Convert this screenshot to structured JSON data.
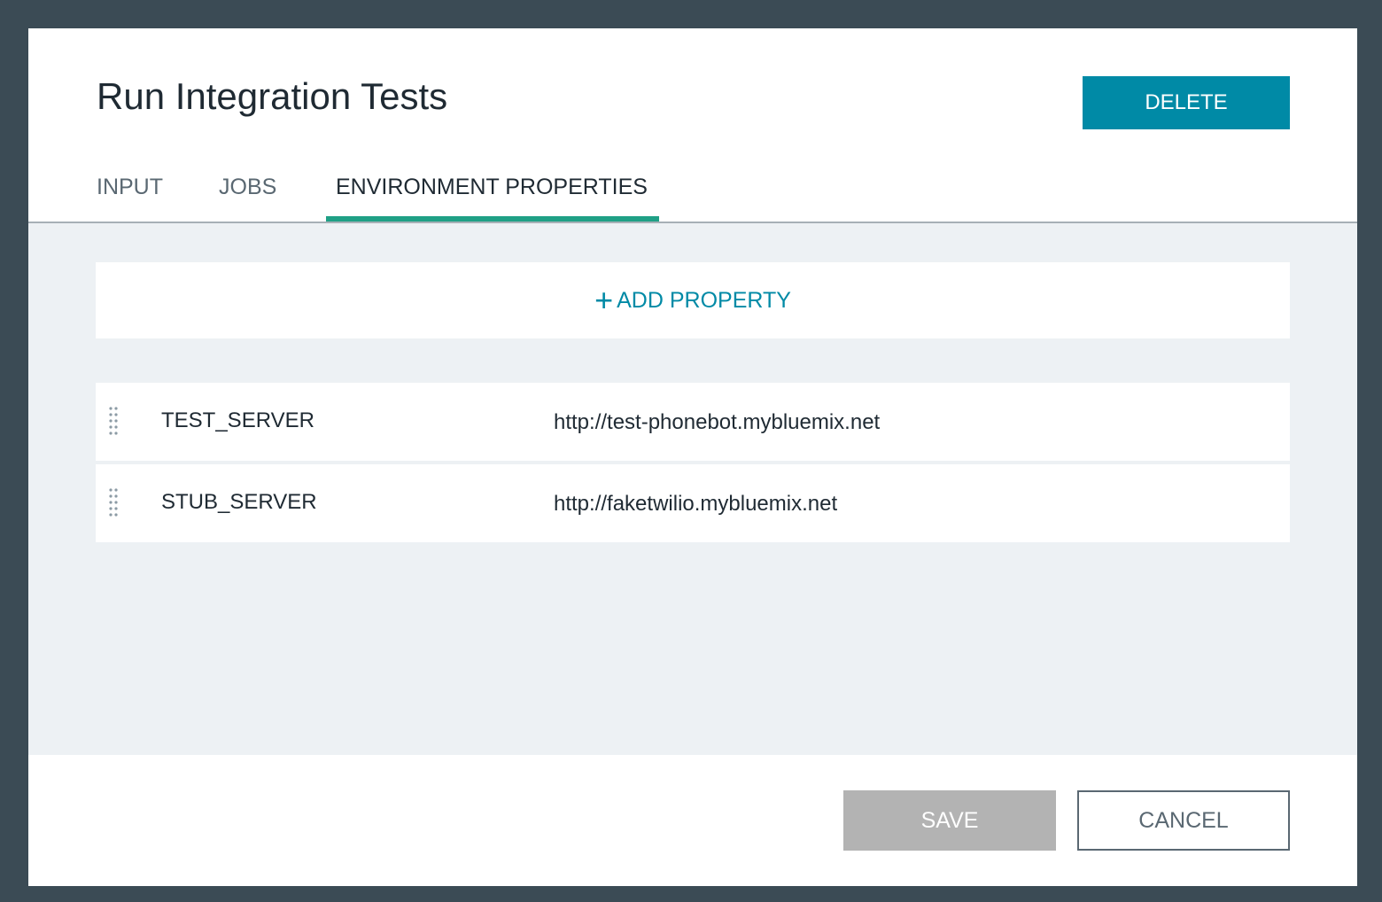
{
  "dialog": {
    "title": "Run Integration Tests",
    "delete_label": "DELETE"
  },
  "tabs": [
    {
      "label": "INPUT",
      "active": false
    },
    {
      "label": "JOBS",
      "active": false
    },
    {
      "label": "ENVIRONMENT PROPERTIES",
      "active": true
    }
  ],
  "add_property": {
    "icon": "plus-icon",
    "label": "ADD PROPERTY"
  },
  "properties": [
    {
      "key": "TEST_SERVER",
      "value": "http://test-phonebot.mybluemix.net"
    },
    {
      "key": "STUB_SERVER",
      "value": "http://faketwilio.mybluemix.net"
    }
  ],
  "footer": {
    "save_label": "SAVE",
    "cancel_label": "CANCEL"
  },
  "colors": {
    "accent": "#008aa6",
    "tab_indicator": "#1fa086",
    "backdrop": "#3b4b55",
    "content_bg": "#edf1f4",
    "save_disabled": "#b3b3b3"
  }
}
